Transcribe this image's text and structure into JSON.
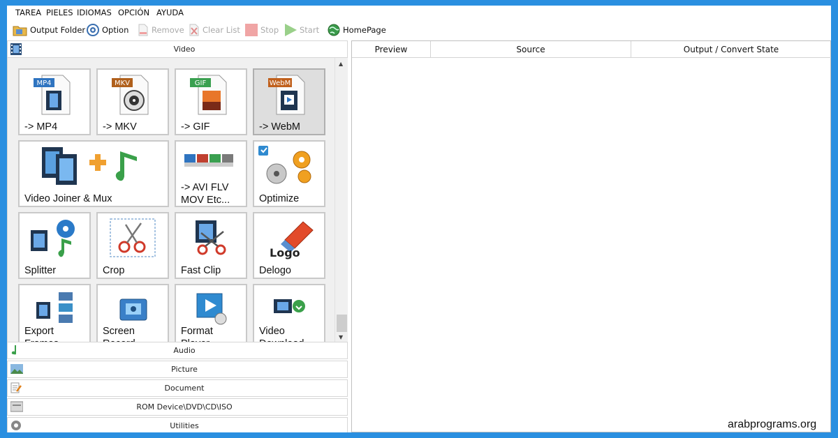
{
  "menu": [
    "TAREA",
    "PIELES",
    "IDIOMAS",
    "OPCIÓN",
    "AYUDA"
  ],
  "toolbar": {
    "output_folder": "Output Folder",
    "option": "Option",
    "remove": "Remove",
    "clear_list": "Clear List",
    "stop": "Stop",
    "start": "Start",
    "homepage": "HomePage"
  },
  "left": {
    "video_header": "Video",
    "tiles": [
      {
        "label": "-> MP4",
        "badge": "MP4",
        "icon": "mp4-file-icon"
      },
      {
        "label": "-> MKV",
        "badge": "MKV",
        "icon": "mkv-file-icon"
      },
      {
        "label": "-> GIF",
        "badge": "GIF",
        "icon": "gif-file-icon"
      },
      {
        "label": "-> WebM",
        "badge": "WebM",
        "icon": "webm-file-icon"
      },
      {
        "label": "Video Joiner & Mux",
        "icon": "video-joiner-icon"
      },
      {
        "label": "-> AVI FLV MOV Etc...",
        "icon": "multi-format-icon"
      },
      {
        "label": "Optimize",
        "icon": "optimize-icon"
      },
      {
        "label": "Splitter",
        "icon": "splitter-icon"
      },
      {
        "label": "Crop",
        "icon": "crop-icon"
      },
      {
        "label": "Fast Clip",
        "icon": "fast-clip-icon"
      },
      {
        "label": "Delogo",
        "logo_text": "Logo",
        "icon": "delogo-icon"
      },
      {
        "label": "Export Frames",
        "icon": "export-frames-icon"
      },
      {
        "label": "Screen Record",
        "icon": "screen-record-icon"
      },
      {
        "label": "Format Player",
        "icon": "format-player-icon"
      },
      {
        "label": "Video Download",
        "icon": "video-download-icon"
      }
    ],
    "categories": {
      "audio": "Audio",
      "picture": "Picture",
      "document": "Document",
      "rom": "ROM Device\\DVD\\CD\\ISO",
      "utilities": "Utilities"
    }
  },
  "table": {
    "columns": [
      "Preview",
      "Source",
      "Output / Convert State"
    ]
  },
  "watermark": "arabprograms.org",
  "colors": {
    "frame": "#2a8fe0",
    "tile_border": "#c9c9c9",
    "tile_selected": "#dedede"
  }
}
